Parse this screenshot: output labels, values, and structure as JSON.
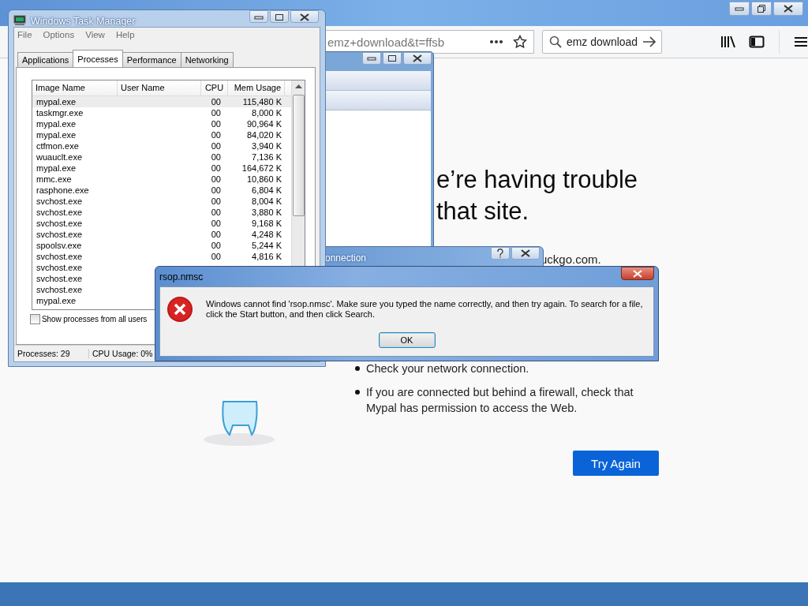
{
  "browser": {
    "url_text": "emz+download&t=ffsb",
    "search_text": "emz download",
    "heading": [
      "e’re having trouble",
      "that site."
    ],
    "partial_line": "uckgo.com.",
    "bullets": [
      "Check your network connection.",
      "If you are connected but behind a firewall, check that Mypal has permission to access the Web."
    ],
    "button": "Try Again"
  },
  "connection_dialog": {
    "title": "onnection"
  },
  "task_manager": {
    "title": "Windows Task Manager",
    "menu": [
      "File",
      "Options",
      "View",
      "Help"
    ],
    "tabs": [
      {
        "label": "Applications",
        "selected": false
      },
      {
        "label": "Processes",
        "selected": true
      },
      {
        "label": "Performance",
        "selected": false
      },
      {
        "label": "Networking",
        "selected": false
      }
    ],
    "columns": [
      "Image Name",
      "User Name",
      "CPU",
      "Mem Usage"
    ],
    "rows": [
      {
        "image": "mypal.exe",
        "cpu": "00",
        "mem": "115,480 K",
        "selected": true
      },
      {
        "image": "taskmgr.exe",
        "cpu": "00",
        "mem": "8,000 K",
        "selected": false
      },
      {
        "image": "mypal.exe",
        "cpu": "00",
        "mem": "90,964 K",
        "selected": false
      },
      {
        "image": "mypal.exe",
        "cpu": "00",
        "mem": "84,020 K",
        "selected": false
      },
      {
        "image": "ctfmon.exe",
        "cpu": "00",
        "mem": "3,940 K",
        "selected": false
      },
      {
        "image": "wuauclt.exe",
        "cpu": "00",
        "mem": "7,136 K",
        "selected": false
      },
      {
        "image": "mypal.exe",
        "cpu": "00",
        "mem": "164,672 K",
        "selected": false
      },
      {
        "image": "mmc.exe",
        "cpu": "00",
        "mem": "10,860 K",
        "selected": false
      },
      {
        "image": "rasphone.exe",
        "cpu": "00",
        "mem": "6,804 K",
        "selected": false
      },
      {
        "image": "svchost.exe",
        "cpu": "00",
        "mem": "8,004 K",
        "selected": false
      },
      {
        "image": "svchost.exe",
        "cpu": "00",
        "mem": "3,880 K",
        "selected": false
      },
      {
        "image": "svchost.exe",
        "cpu": "00",
        "mem": "9,168 K",
        "selected": false
      },
      {
        "image": "svchost.exe",
        "cpu": "00",
        "mem": "4,248 K",
        "selected": false
      },
      {
        "image": "spoolsv.exe",
        "cpu": "00",
        "mem": "5,244 K",
        "selected": false
      },
      {
        "image": "svchost.exe",
        "cpu": "00",
        "mem": "4,816 K",
        "selected": false
      },
      {
        "image": "svchost.exe",
        "selected": false
      },
      {
        "image": "svchost.exe",
        "selected": false
      },
      {
        "image": "svchost.exe",
        "selected": false
      },
      {
        "image": "mypal.exe",
        "selected": false
      }
    ],
    "show_all_users": {
      "label": "Show processes from all users",
      "checked": false
    },
    "status": [
      "Processes: 29",
      "CPU Usage: 0%"
    ]
  },
  "error_dialog": {
    "title": "rsop.nmsc",
    "message": "Windows cannot find 'rsop.nmsc'. Make sure you typed the name correctly, and then try again. To search for a file, click the Start button, and then click Search.",
    "button": "OK"
  }
}
